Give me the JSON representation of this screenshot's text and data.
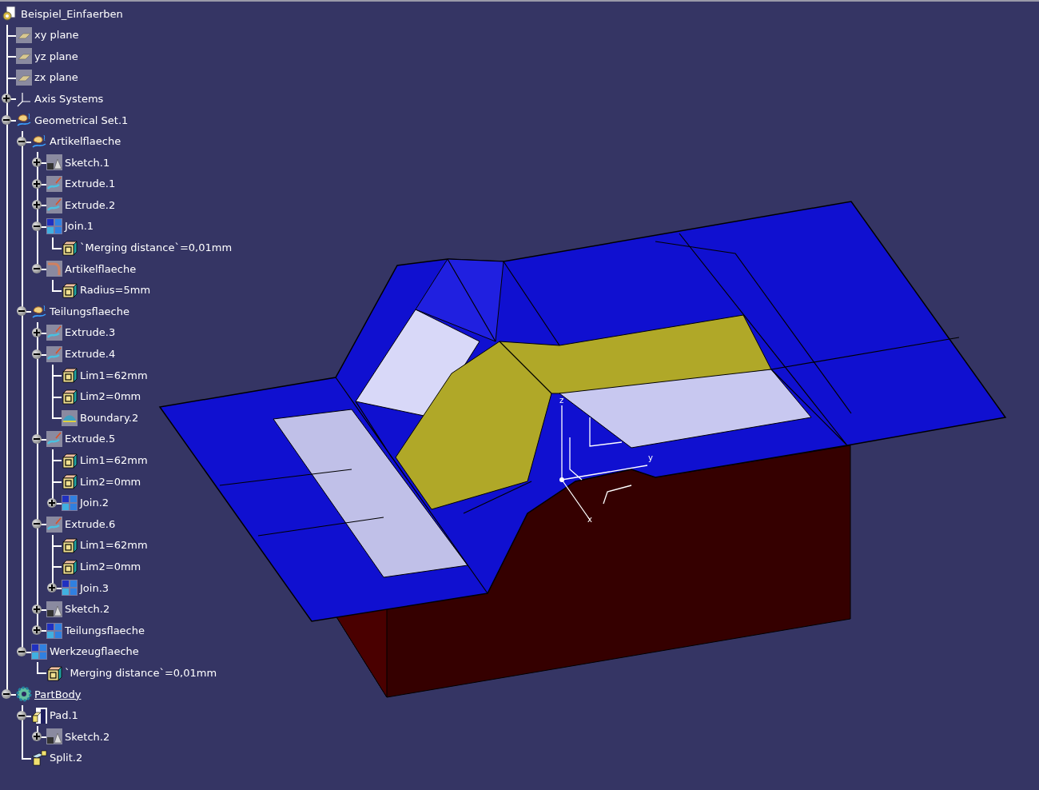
{
  "tree": {
    "label": "Beispiel_Einfaerben",
    "kind": "part",
    "children": [
      {
        "label": "xy plane",
        "kind": "plane"
      },
      {
        "label": "yz plane",
        "kind": "plane"
      },
      {
        "label": "zx plane",
        "kind": "plane"
      },
      {
        "label": "Axis Systems",
        "kind": "axis",
        "expanded": false
      },
      {
        "label": "Geometrical Set.1",
        "kind": "geoset",
        "expanded": true,
        "children": [
          {
            "label": "Artikelflaeche",
            "kind": "geoset",
            "expanded": true,
            "children": [
              {
                "label": "Sketch.1",
                "kind": "sketch",
                "expanded": false
              },
              {
                "label": "Extrude.1",
                "kind": "extrude",
                "expanded": false
              },
              {
                "label": "Extrude.2",
                "kind": "extrude",
                "expanded": false
              },
              {
                "label": "Join.1",
                "kind": "join",
                "expanded": true,
                "children": [
                  {
                    "label": "`Merging distance`=0,01mm",
                    "kind": "param"
                  }
                ]
              },
              {
                "label": "Artikelflaeche",
                "kind": "fillet",
                "expanded": true,
                "children": [
                  {
                    "label": "Radius=5mm",
                    "kind": "param"
                  }
                ]
              }
            ]
          },
          {
            "label": "Teilungsflaeche",
            "kind": "geoset",
            "expanded": true,
            "children": [
              {
                "label": "Extrude.3",
                "kind": "extrude",
                "expanded": false
              },
              {
                "label": "Extrude.4",
                "kind": "extrude",
                "expanded": true,
                "children": [
                  {
                    "label": "Lim1=62mm",
                    "kind": "param"
                  },
                  {
                    "label": "Lim2=0mm",
                    "kind": "param"
                  },
                  {
                    "label": "Boundary.2",
                    "kind": "boundary"
                  }
                ]
              },
              {
                "label": "Extrude.5",
                "kind": "extrude",
                "expanded": true,
                "children": [
                  {
                    "label": "Lim1=62mm",
                    "kind": "param"
                  },
                  {
                    "label": "Lim2=0mm",
                    "kind": "param"
                  },
                  {
                    "label": "Join.2",
                    "kind": "join",
                    "expanded": false
                  }
                ]
              },
              {
                "label": "Extrude.6",
                "kind": "extrude",
                "expanded": true,
                "children": [
                  {
                    "label": "Lim1=62mm",
                    "kind": "param"
                  },
                  {
                    "label": "Lim2=0mm",
                    "kind": "param"
                  },
                  {
                    "label": "Join.3",
                    "kind": "join",
                    "expanded": false
                  }
                ]
              },
              {
                "label": "Sketch.2",
                "kind": "sketch",
                "expanded": false
              },
              {
                "label": "Teilungsflaeche",
                "kind": "join",
                "expanded": false
              }
            ]
          },
          {
            "label": "Werkzeugflaeche",
            "kind": "join",
            "expanded": true,
            "children": [
              {
                "label": "`Merging distance`=0,01mm",
                "kind": "param"
              }
            ]
          }
        ]
      },
      {
        "label": "PartBody",
        "kind": "body",
        "expanded": true,
        "current": true,
        "children": [
          {
            "label": "Pad.1",
            "kind": "pad",
            "expanded": true,
            "children": [
              {
                "label": "Sketch.2",
                "kind": "sketch",
                "expanded": false
              }
            ]
          },
          {
            "label": "Split.2",
            "kind": "split"
          }
        ]
      }
    ]
  },
  "viewport": {
    "axis_labels": [
      "z",
      "y",
      "x"
    ]
  }
}
